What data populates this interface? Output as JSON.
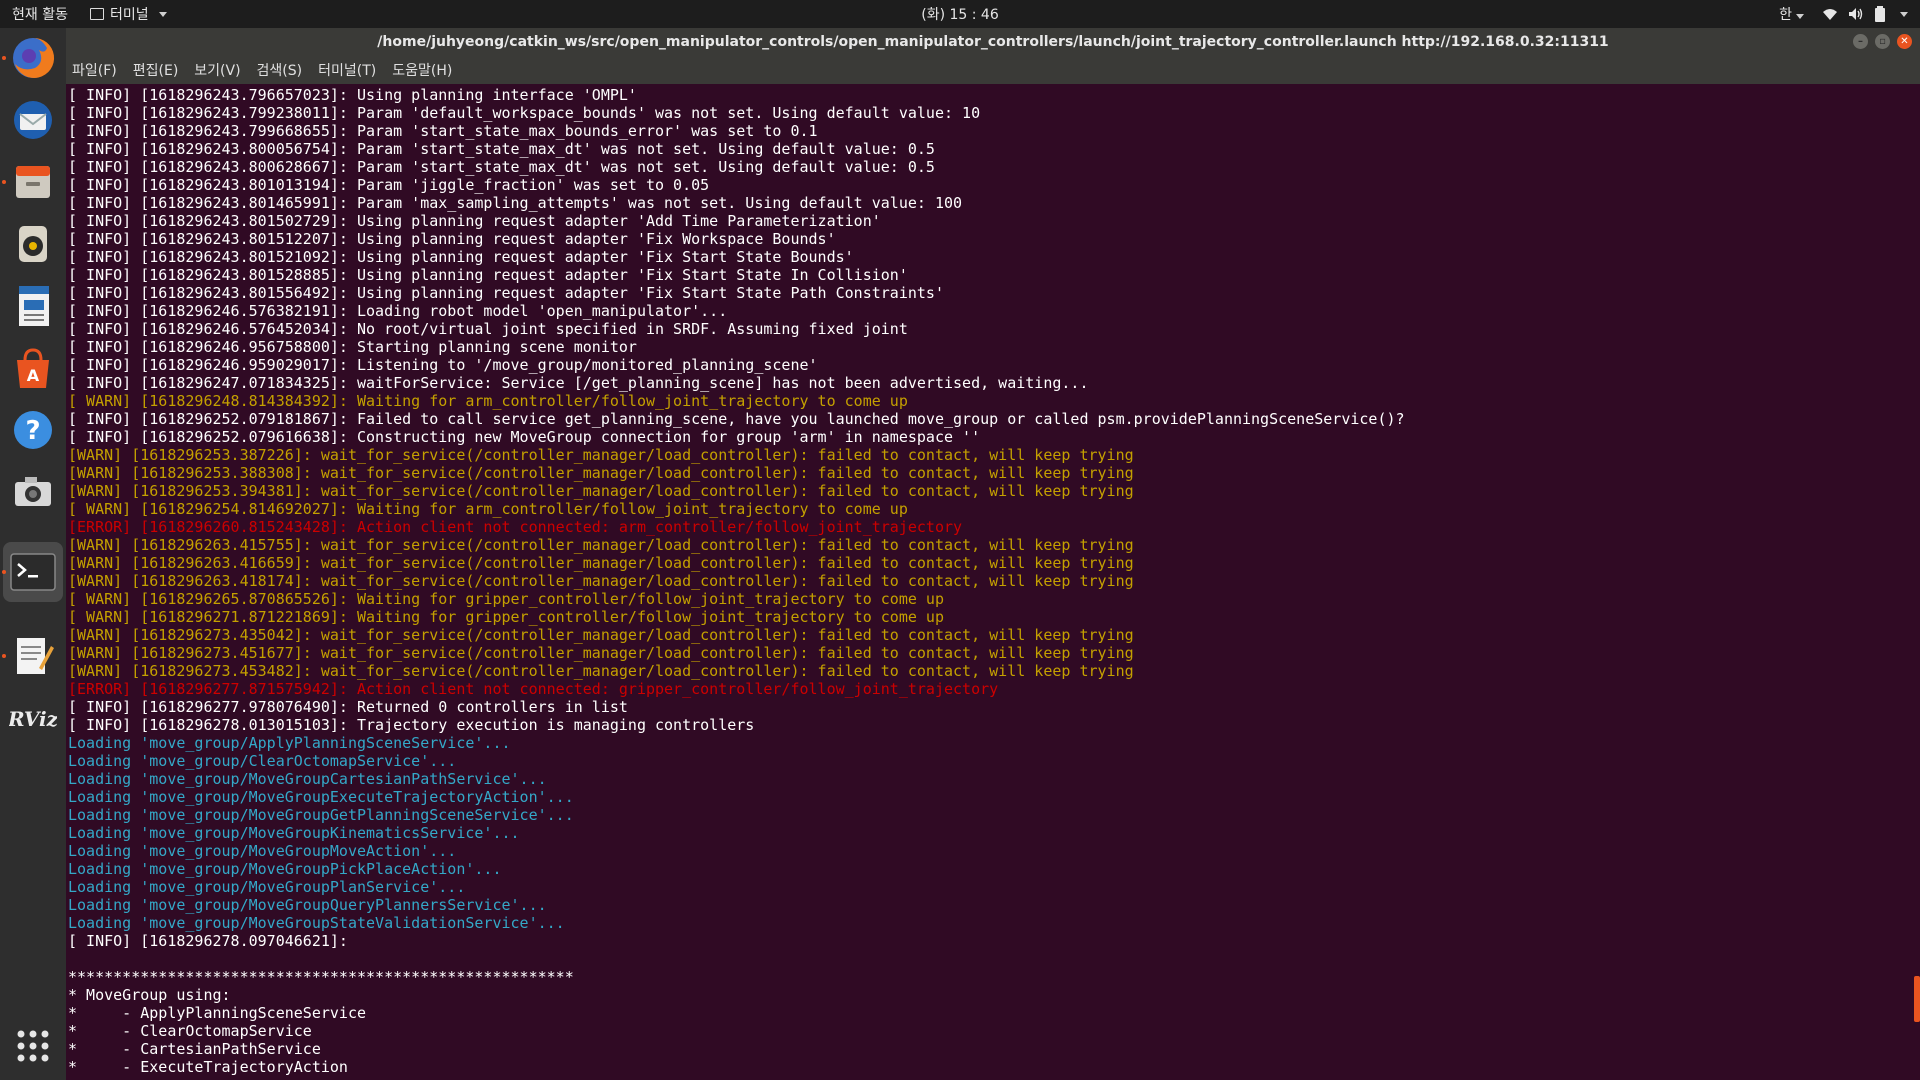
{
  "topbar": {
    "activities": "현재 활동",
    "app_name": "터미널",
    "clock": "(화) 15 : 46",
    "input_method": "한"
  },
  "window": {
    "title": "/home/juhyeong/catkin_ws/src/open_manipulator_controls/open_manipulator_controllers/launch/joint_trajectory_controller.launch http://192.168.0.32:11311"
  },
  "menubar": [
    "파일(F)",
    "편집(E)",
    "보기(V)",
    "검색(S)",
    "터미널(T)",
    "도움말(H)"
  ],
  "dock": {
    "items": [
      "firefox-icon",
      "thunderbird-icon",
      "files-icon",
      "rhythmbox-icon",
      "writer-icon",
      "software-icon",
      "help-icon",
      "camera-icon",
      "terminal-icon",
      "text-editor-icon",
      "rviz-icon",
      "app-grid-icon"
    ]
  },
  "terminal": {
    "lines": [
      {
        "t": "info",
        "s": "[ INFO] [1618296243.796657023]: Using planning interface 'OMPL'"
      },
      {
        "t": "info",
        "s": "[ INFO] [1618296243.799238011]: Param 'default_workspace_bounds' was not set. Using default value: 10"
      },
      {
        "t": "info",
        "s": "[ INFO] [1618296243.799668655]: Param 'start_state_max_bounds_error' was set to 0.1"
      },
      {
        "t": "info",
        "s": "[ INFO] [1618296243.800056754]: Param 'start_state_max_dt' was not set. Using default value: 0.5"
      },
      {
        "t": "info",
        "s": "[ INFO] [1618296243.800628667]: Param 'start_state_max_dt' was not set. Using default value: 0.5"
      },
      {
        "t": "info",
        "s": "[ INFO] [1618296243.801013194]: Param 'jiggle_fraction' was set to 0.05"
      },
      {
        "t": "info",
        "s": "[ INFO] [1618296243.801465991]: Param 'max_sampling_attempts' was not set. Using default value: 100"
      },
      {
        "t": "info",
        "s": "[ INFO] [1618296243.801502729]: Using planning request adapter 'Add Time Parameterization'"
      },
      {
        "t": "info",
        "s": "[ INFO] [1618296243.801512207]: Using planning request adapter 'Fix Workspace Bounds'"
      },
      {
        "t": "info",
        "s": "[ INFO] [1618296243.801521092]: Using planning request adapter 'Fix Start State Bounds'"
      },
      {
        "t": "info",
        "s": "[ INFO] [1618296243.801528885]: Using planning request adapter 'Fix Start State In Collision'"
      },
      {
        "t": "info",
        "s": "[ INFO] [1618296243.801556492]: Using planning request adapter 'Fix Start State Path Constraints'"
      },
      {
        "t": "info",
        "s": "[ INFO] [1618296246.576382191]: Loading robot model 'open_manipulator'..."
      },
      {
        "t": "info",
        "s": "[ INFO] [1618296246.576452034]: No root/virtual joint specified in SRDF. Assuming fixed joint"
      },
      {
        "t": "info",
        "s": "[ INFO] [1618296246.956758800]: Starting planning scene monitor"
      },
      {
        "t": "info",
        "s": "[ INFO] [1618296246.959029017]: Listening to '/move_group/monitored_planning_scene'"
      },
      {
        "t": "info",
        "s": "[ INFO] [1618296247.071834325]: waitForService: Service [/get_planning_scene] has not been advertised, waiting..."
      },
      {
        "t": "warn",
        "s": "[ WARN] [1618296248.814384392]: Waiting for arm_controller/follow_joint_trajectory to come up"
      },
      {
        "t": "info",
        "s": "[ INFO] [1618296252.079181867]: Failed to call service get_planning_scene, have you launched move_group or called psm.providePlanningSceneService()?"
      },
      {
        "t": "info",
        "s": "[ INFO] [1618296252.079616638]: Constructing new MoveGroup connection for group 'arm' in namespace ''"
      },
      {
        "t": "warn",
        "s": "[WARN] [1618296253.387226]: wait_for_service(/controller_manager/load_controller): failed to contact, will keep trying"
      },
      {
        "t": "warn",
        "s": "[WARN] [1618296253.388308]: wait_for_service(/controller_manager/load_controller): failed to contact, will keep trying"
      },
      {
        "t": "warn",
        "s": "[WARN] [1618296253.394381]: wait_for_service(/controller_manager/load_controller): failed to contact, will keep trying"
      },
      {
        "t": "warn",
        "s": "[ WARN] [1618296254.814692027]: Waiting for arm_controller/follow_joint_trajectory to come up"
      },
      {
        "t": "error",
        "s": "[ERROR] [1618296260.815243428]: Action client not connected: arm_controller/follow_joint_trajectory"
      },
      {
        "t": "warn",
        "s": "[WARN] [1618296263.415755]: wait_for_service(/controller_manager/load_controller): failed to contact, will keep trying"
      },
      {
        "t": "warn",
        "s": "[WARN] [1618296263.416659]: wait_for_service(/controller_manager/load_controller): failed to contact, will keep trying"
      },
      {
        "t": "warn",
        "s": "[WARN] [1618296263.418174]: wait_for_service(/controller_manager/load_controller): failed to contact, will keep trying"
      },
      {
        "t": "warn",
        "s": "[ WARN] [1618296265.870865526]: Waiting for gripper_controller/follow_joint_trajectory to come up"
      },
      {
        "t": "warn",
        "s": "[ WARN] [1618296271.871221869]: Waiting for gripper_controller/follow_joint_trajectory to come up"
      },
      {
        "t": "warn",
        "s": "[WARN] [1618296273.435042]: wait_for_service(/controller_manager/load_controller): failed to contact, will keep trying"
      },
      {
        "t": "warn",
        "s": "[WARN] [1618296273.451677]: wait_for_service(/controller_manager/load_controller): failed to contact, will keep trying"
      },
      {
        "t": "warn",
        "s": "[WARN] [1618296273.453482]: wait_for_service(/controller_manager/load_controller): failed to contact, will keep trying"
      },
      {
        "t": "error",
        "s": "[ERROR] [1618296277.871575942]: Action client not connected: gripper_controller/follow_joint_trajectory"
      },
      {
        "t": "info",
        "s": "[ INFO] [1618296277.978076490]: Returned 0 controllers in list"
      },
      {
        "t": "info",
        "s": "[ INFO] [1618296278.013015103]: Trajectory execution is managing controllers"
      },
      {
        "t": "load",
        "s": "Loading 'move_group/ApplyPlanningSceneService'..."
      },
      {
        "t": "load",
        "s": "Loading 'move_group/ClearOctomapService'..."
      },
      {
        "t": "load",
        "s": "Loading 'move_group/MoveGroupCartesianPathService'..."
      },
      {
        "t": "load",
        "s": "Loading 'move_group/MoveGroupExecuteTrajectoryAction'..."
      },
      {
        "t": "load",
        "s": "Loading 'move_group/MoveGroupGetPlanningSceneService'..."
      },
      {
        "t": "load",
        "s": "Loading 'move_group/MoveGroupKinematicsService'..."
      },
      {
        "t": "load",
        "s": "Loading 'move_group/MoveGroupMoveAction'..."
      },
      {
        "t": "load",
        "s": "Loading 'move_group/MoveGroupPickPlaceAction'..."
      },
      {
        "t": "load",
        "s": "Loading 'move_group/MoveGroupPlanService'..."
      },
      {
        "t": "load",
        "s": "Loading 'move_group/MoveGroupQueryPlannersService'..."
      },
      {
        "t": "load",
        "s": "Loading 'move_group/MoveGroupStateValidationService'..."
      },
      {
        "t": "info",
        "s": "[ INFO] [1618296278.097046621]:"
      },
      {
        "t": "plain",
        "s": ""
      },
      {
        "t": "plain",
        "s": "********************************************************"
      },
      {
        "t": "plain",
        "s": "* MoveGroup using:"
      },
      {
        "t": "plain",
        "s": "*     - ApplyPlanningSceneService"
      },
      {
        "t": "plain",
        "s": "*     - ClearOctomapService"
      },
      {
        "t": "plain",
        "s": "*     - CartesianPathService"
      },
      {
        "t": "plain",
        "s": "*     - ExecuteTrajectoryAction"
      }
    ]
  },
  "colors": {
    "terminal_bg": "#300a24",
    "warn": "#c4a000",
    "error": "#cc0000",
    "loading": "#34a8c8",
    "accent": "#e95420"
  }
}
